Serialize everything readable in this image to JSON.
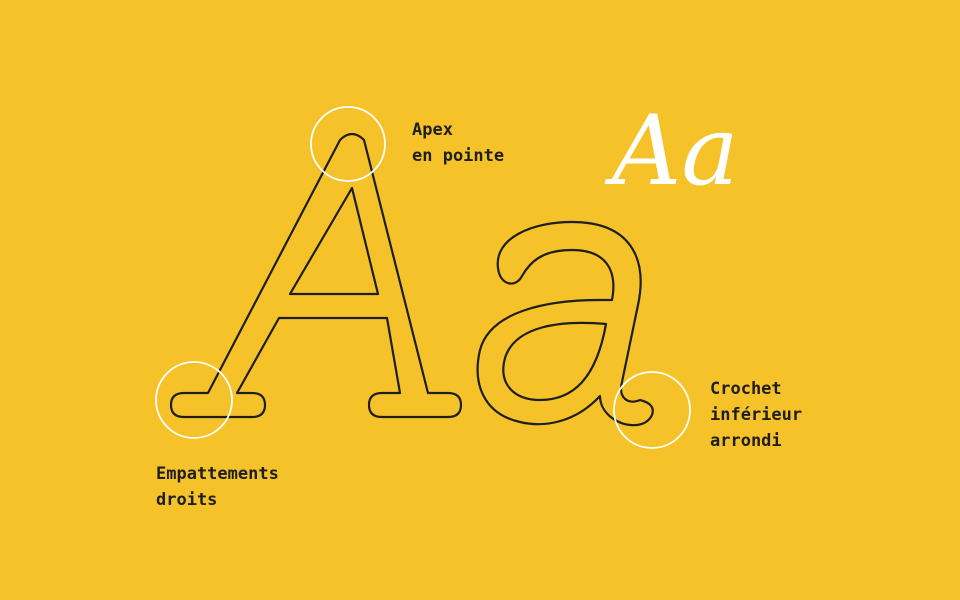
{
  "colors": {
    "background": "#F5C329",
    "outline": "#1E1E1E",
    "highlight": "#FFFFFF"
  },
  "sample_glyphs": "Aa",
  "annotations": {
    "apex": [
      "Apex",
      "en pointe"
    ],
    "serifs": [
      "Empattements",
      "droits"
    ],
    "hook": [
      "Crochet",
      "inférieur",
      "arrondi"
    ]
  }
}
